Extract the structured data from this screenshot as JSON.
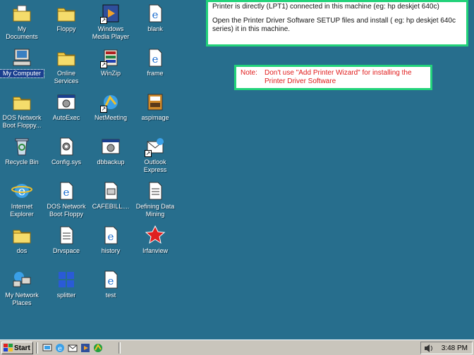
{
  "desktop": {
    "icons": [
      {
        "label": "My Documents",
        "icon": "folder-documents-icon"
      },
      {
        "label": "Floppy",
        "icon": "folder-icon"
      },
      {
        "label": "Windows Media Player",
        "icon": "media-player-icon"
      },
      {
        "label": "blank",
        "icon": "ie-document-icon"
      },
      {
        "label": "My Computer",
        "icon": "computer-icon"
      },
      {
        "label": "Online Services",
        "icon": "folder-icon"
      },
      {
        "label": "WinZip",
        "icon": "winzip-icon"
      },
      {
        "label": "frame",
        "icon": "ie-document-icon"
      },
      {
        "label": "DOS Network Boot Floppy...",
        "icon": "folder-icon"
      },
      {
        "label": "AutoExec",
        "icon": "settings-window-icon"
      },
      {
        "label": "NetMeeting",
        "icon": "netmeeting-icon"
      },
      {
        "label": "aspimage",
        "icon": "aspimage-icon"
      },
      {
        "label": "Recycle Bin",
        "icon": "recycle-bin-icon"
      },
      {
        "label": "Config.sys",
        "icon": "gear-file-icon"
      },
      {
        "label": "dbbackup",
        "icon": "settings-window-icon"
      },
      {
        "label": "Outlook Express",
        "icon": "outlook-express-icon"
      },
      {
        "label": "Internet Explorer",
        "icon": "internet-explorer-icon"
      },
      {
        "label": "DOS Network Boot Floppy",
        "icon": "ie-document-icon"
      },
      {
        "label": "CAFEBILL....",
        "icon": "file-icon"
      },
      {
        "label": "Defining Data Mining",
        "icon": "document-icon"
      },
      {
        "label": "dos",
        "icon": "folder-icon"
      },
      {
        "label": "Drvspace",
        "icon": "document-icon"
      },
      {
        "label": "history",
        "icon": "ie-document-icon"
      },
      {
        "label": "Irfanview",
        "icon": "irfanview-icon"
      },
      {
        "label": "My Network Places",
        "icon": "network-icon"
      },
      {
        "label": "splitter",
        "icon": "splitter-icon"
      },
      {
        "label": "test",
        "icon": "ie-document-icon"
      }
    ]
  },
  "notes": {
    "box1": {
      "line1": "Printer is directly (LPT1) connected in this machine (eg: hp deskjet 640c)",
      "line2": "Open the Printer Driver Software SETUP files and install ( eg: hp deskjet 640c series) it in this machine."
    },
    "box2": {
      "prefix": "Note:",
      "line1": "Don't use \"Add Printer Wizard\" for installing the",
      "line2": "Printer Driver Software"
    }
  },
  "taskbar": {
    "start_label": "Start",
    "quick_launch": [
      "desktop-icon",
      "internet-explorer-icon",
      "outlook-express-icon",
      "media-player-icon",
      "netmeeting-icon"
    ],
    "clock": "3:48 PM"
  },
  "colors": {
    "desktop": "#276e8d",
    "note_border": "#22d27a",
    "note_red": "#e01a1a",
    "taskbar": "#c9c5bc"
  }
}
